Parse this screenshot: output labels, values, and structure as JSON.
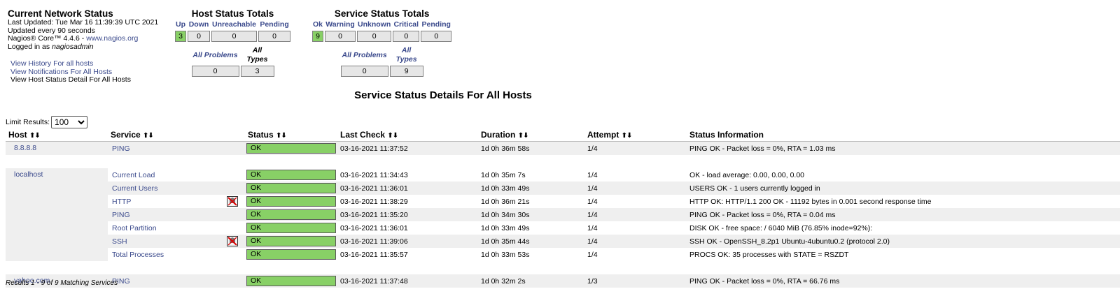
{
  "info": {
    "title": "Current Network Status",
    "last_updated": "Last Updated: Tue Mar 16 11:39:39 UTC 2021",
    "update_interval": "Updated every 90 seconds",
    "version_prefix": "Nagios® Core™ 4.4.6 - ",
    "version_link": "www.nagios.org",
    "logged_in_prefix": "Logged in as ",
    "user": "nagiosadmin"
  },
  "nav": {
    "history": "View History For all hosts",
    "notifications": "View Notifications For All Hosts",
    "current": "View Host Status Detail For All Hosts"
  },
  "host_totals": {
    "title": "Host Status Totals",
    "headers": [
      "Up",
      "Down",
      "Unreachable",
      "Pending"
    ],
    "values": [
      "3",
      "0",
      "0",
      "0"
    ],
    "sub_headers": [
      "All Problems",
      "All Types"
    ],
    "sub_values": [
      "0",
      "3"
    ]
  },
  "service_totals": {
    "title": "Service Status Totals",
    "headers": [
      "Ok",
      "Warning",
      "Unknown",
      "Critical",
      "Pending"
    ],
    "values": [
      "9",
      "0",
      "0",
      "0",
      "0"
    ],
    "sub_headers": [
      "All Problems",
      "All Types"
    ],
    "sub_values": [
      "0",
      "9"
    ]
  },
  "page_heading": "Service Status Details For All Hosts",
  "limit": {
    "label": "Limit Results:",
    "selected": "100"
  },
  "table": {
    "columns": [
      "Host",
      "Service",
      "Status",
      "Last Check",
      "Duration",
      "Attempt",
      "Status Information"
    ],
    "sort_arrows": "⬆⬇",
    "hosts": [
      {
        "name": "8.8.8.8",
        "services": [
          {
            "service": "PING",
            "status": "OK",
            "last_check": "03-16-2021 11:37:52",
            "duration": "1d 0h 36m 58s",
            "attempt": "1/4",
            "info": "PING OK - Packet loss = 0%, RTA = 1.03 ms",
            "flap": false
          }
        ]
      },
      {
        "name": "localhost",
        "services": [
          {
            "service": "Current Load",
            "status": "OK",
            "last_check": "03-16-2021 11:34:43",
            "duration": "1d 0h 35m 7s",
            "attempt": "1/4",
            "info": "OK - load average: 0.00, 0.00, 0.00",
            "flap": false
          },
          {
            "service": "Current Users",
            "status": "OK",
            "last_check": "03-16-2021 11:36:01",
            "duration": "1d 0h 33m 49s",
            "attempt": "1/4",
            "info": "USERS OK - 1 users currently logged in",
            "flap": false
          },
          {
            "service": "HTTP",
            "status": "OK",
            "last_check": "03-16-2021 11:38:29",
            "duration": "1d 0h 36m 21s",
            "attempt": "1/4",
            "info": "HTTP OK: HTTP/1.1 200 OK - 11192 bytes in 0.001 second response time",
            "flap": true
          },
          {
            "service": "PING",
            "status": "OK",
            "last_check": "03-16-2021 11:35:20",
            "duration": "1d 0h 34m 30s",
            "attempt": "1/4",
            "info": "PING OK - Packet loss = 0%, RTA = 0.04 ms",
            "flap": false
          },
          {
            "service": "Root Partition",
            "status": "OK",
            "last_check": "03-16-2021 11:36:01",
            "duration": "1d 0h 33m 49s",
            "attempt": "1/4",
            "info": "DISK OK - free space: / 6040 MiB (76.85% inode=92%):",
            "flap": false
          },
          {
            "service": "SSH",
            "status": "OK",
            "last_check": "03-16-2021 11:39:06",
            "duration": "1d 0h 35m 44s",
            "attempt": "1/4",
            "info": "SSH OK - OpenSSH_8.2p1 Ubuntu-4ubuntu0.2 (protocol 2.0)",
            "flap": true
          },
          {
            "service": "Total Processes",
            "status": "OK",
            "last_check": "03-16-2021 11:35:57",
            "duration": "1d 0h 33m 53s",
            "attempt": "1/4",
            "info": "PROCS OK: 35 processes with STATE = RSZDT",
            "flap": false
          }
        ]
      },
      {
        "name": "yahoo.com",
        "services": [
          {
            "service": "PING",
            "status": "OK",
            "last_check": "03-16-2021 11:37:48",
            "duration": "1d 0h 32m 2s",
            "attempt": "1/3",
            "info": "PING OK - Packet loss = 0%, RTA = 66.76 ms",
            "flap": false
          }
        ]
      }
    ]
  },
  "footer": "Results 1 - 9 of 9 Matching Services",
  "colors": {
    "ok": "#88d066",
    "link": "#3b4a8c",
    "row_alt": "#efefef"
  }
}
